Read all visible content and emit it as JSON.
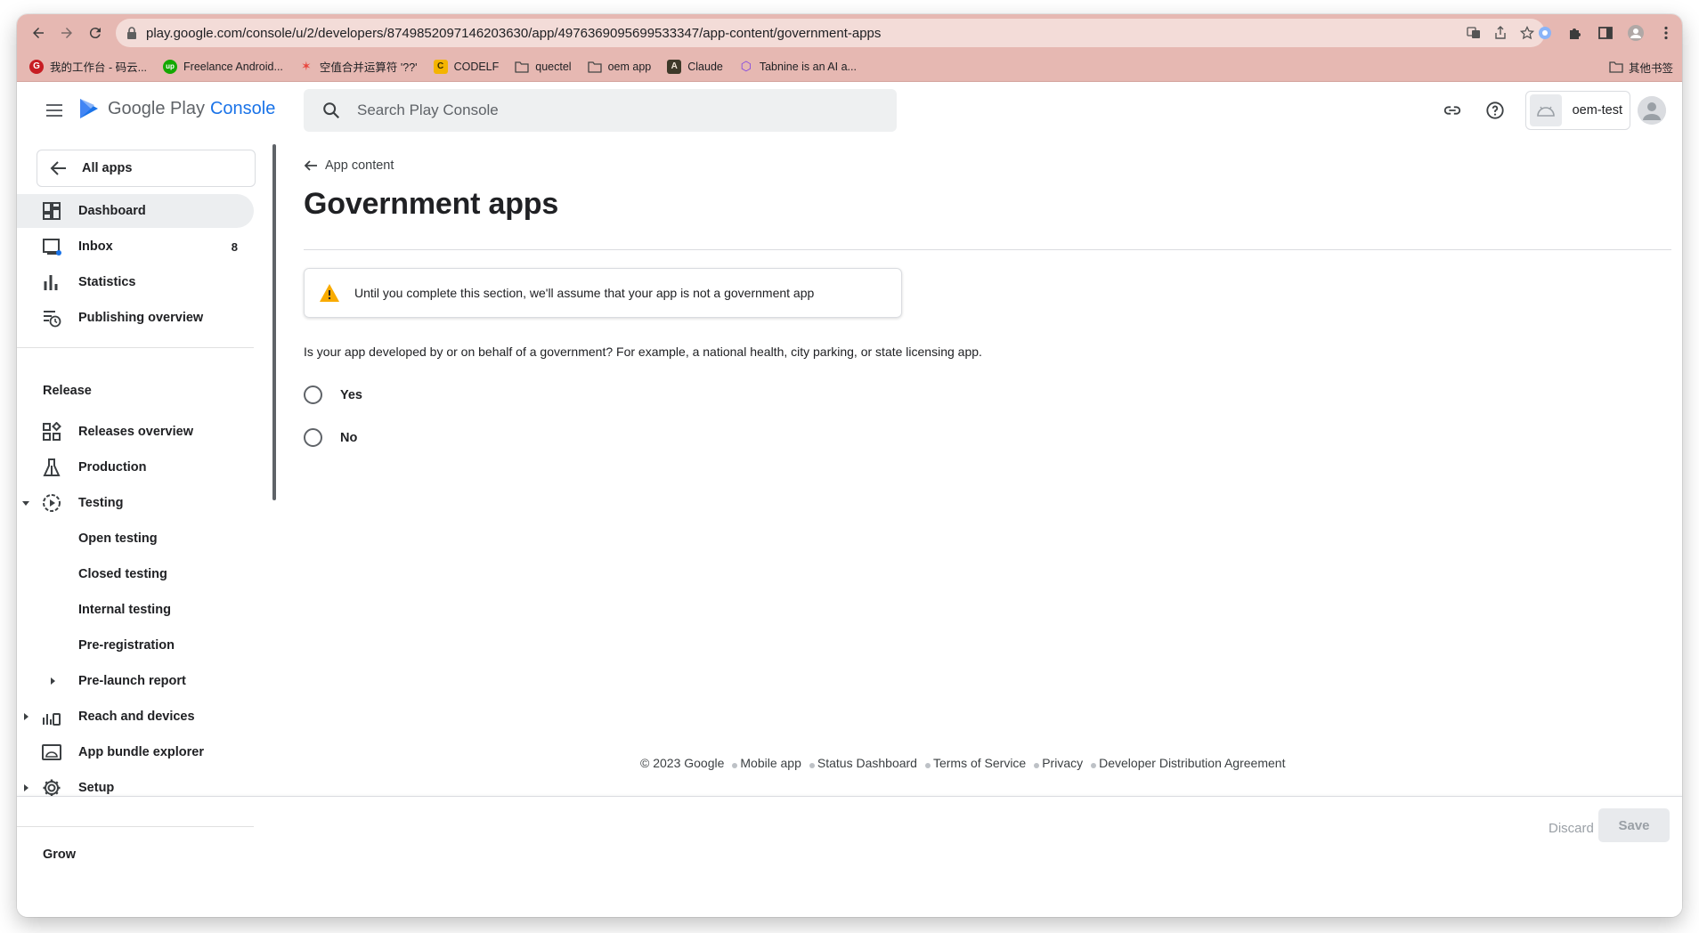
{
  "browser": {
    "url": "play.google.com/console/u/2/developers/8749852097146203630/app/4976369095699533347/app-content/government-apps",
    "bookmarks": [
      {
        "label": "我的工作台 - 码云...",
        "color": "#c71d23",
        "glyph": "G"
      },
      {
        "label": "Freelance Android...",
        "color": "#14a800",
        "glyph": "up"
      },
      {
        "label": "空值合并运算符 '??'",
        "color": "#e8453c",
        "glyph": "✶"
      },
      {
        "label": "CODELF",
        "color": "#f4b400",
        "glyph": "C"
      },
      {
        "label": "quectel",
        "color": "folder",
        "glyph": ""
      },
      {
        "label": "oem app",
        "color": "folder",
        "glyph": ""
      },
      {
        "label": "Claude",
        "color": "#3d3929",
        "glyph": "A"
      },
      {
        "label": "Tabnine is an AI a...",
        "color": "#7b3fe4",
        "glyph": "◇"
      }
    ],
    "other_bookmarks": "其他书签"
  },
  "header": {
    "brand_google_play": "Google Play",
    "brand_console": "Console",
    "search_placeholder": "Search Play Console",
    "account_name": "oem-test"
  },
  "sidebar": {
    "all_apps": "All apps",
    "dashboard": "Dashboard",
    "inbox": "Inbox",
    "inbox_count": "8",
    "statistics": "Statistics",
    "publishing_overview": "Publishing overview",
    "release_heading": "Release",
    "releases_overview": "Releases overview",
    "production": "Production",
    "testing": "Testing",
    "open_testing": "Open testing",
    "closed_testing": "Closed testing",
    "internal_testing": "Internal testing",
    "pre_registration": "Pre-registration",
    "pre_launch_report": "Pre-launch report",
    "reach_and_devices": "Reach and devices",
    "app_bundle_explorer": "App bundle explorer",
    "setup": "Setup",
    "grow_heading": "Grow"
  },
  "main": {
    "back_label": "App content",
    "title": "Government apps",
    "warning": "Until you complete this section, we'll assume that your app is not a government app",
    "question": "Is your app developed by or on behalf of a government? For example, a national health, city parking, or state licensing app.",
    "options": [
      "Yes",
      "No"
    ]
  },
  "footer": {
    "copyright": "© 2023 Google",
    "links": [
      "Mobile app",
      "Status Dashboard",
      "Terms of Service",
      "Privacy",
      "Developer Distribution Agreement"
    ]
  },
  "actions": {
    "discard": "Discard",
    "save": "Save"
  },
  "colors": {
    "accent": "#1a73e8",
    "browser_chrome": "#e6b8b2",
    "warning": "#f9ab00"
  }
}
